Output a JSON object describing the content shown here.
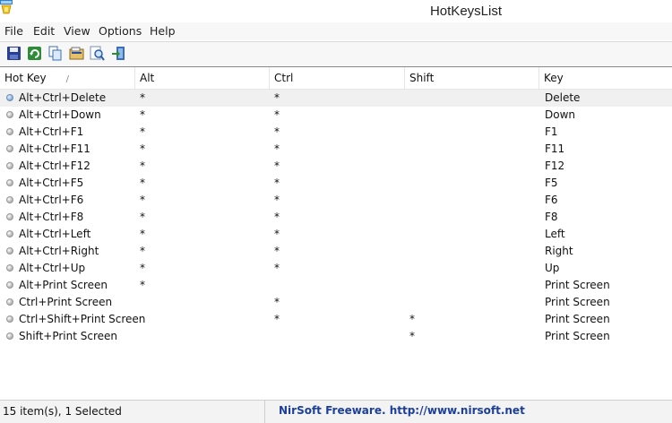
{
  "window": {
    "title": "HotKeysList"
  },
  "menu": [
    "File",
    "Edit",
    "View",
    "Options",
    "Help"
  ],
  "toolbar": [
    {
      "name": "save-icon"
    },
    {
      "name": "refresh-icon"
    },
    {
      "name": "copy-icon"
    },
    {
      "name": "properties-icon"
    },
    {
      "name": "find-icon"
    },
    {
      "name": "exit-icon"
    }
  ],
  "columns": [
    "Hot Key",
    "Alt",
    "Ctrl",
    "Shift",
    "Key"
  ],
  "sort_indicator": "/",
  "rows": [
    {
      "hotkey": "Alt+Ctrl+Delete",
      "alt": "*",
      "ctrl": "*",
      "shift": "",
      "key": "Delete",
      "selected": true
    },
    {
      "hotkey": "Alt+Ctrl+Down",
      "alt": "*",
      "ctrl": "*",
      "shift": "",
      "key": "Down"
    },
    {
      "hotkey": "Alt+Ctrl+F1",
      "alt": "*",
      "ctrl": "*",
      "shift": "",
      "key": "F1"
    },
    {
      "hotkey": "Alt+Ctrl+F11",
      "alt": "*",
      "ctrl": "*",
      "shift": "",
      "key": "F11"
    },
    {
      "hotkey": "Alt+Ctrl+F12",
      "alt": "*",
      "ctrl": "*",
      "shift": "",
      "key": "F12"
    },
    {
      "hotkey": "Alt+Ctrl+F5",
      "alt": "*",
      "ctrl": "*",
      "shift": "",
      "key": "F5"
    },
    {
      "hotkey": "Alt+Ctrl+F6",
      "alt": "*",
      "ctrl": "*",
      "shift": "",
      "key": "F6"
    },
    {
      "hotkey": "Alt+Ctrl+F8",
      "alt": "*",
      "ctrl": "*",
      "shift": "",
      "key": "F8"
    },
    {
      "hotkey": "Alt+Ctrl+Left",
      "alt": "*",
      "ctrl": "*",
      "shift": "",
      "key": "Left"
    },
    {
      "hotkey": "Alt+Ctrl+Right",
      "alt": "*",
      "ctrl": "*",
      "shift": "",
      "key": "Right"
    },
    {
      "hotkey": "Alt+Ctrl+Up",
      "alt": "*",
      "ctrl": "*",
      "shift": "",
      "key": "Up"
    },
    {
      "hotkey": "Alt+Print Screen",
      "alt": "*",
      "ctrl": "",
      "shift": "",
      "key": "Print Screen"
    },
    {
      "hotkey": "Ctrl+Print Screen",
      "alt": "",
      "ctrl": "*",
      "shift": "",
      "key": "Print Screen"
    },
    {
      "hotkey": "Ctrl+Shift+Print Screen",
      "alt": "",
      "ctrl": "*",
      "shift": "*",
      "key": "Print Screen"
    },
    {
      "hotkey": "Shift+Print Screen",
      "alt": "",
      "ctrl": "",
      "shift": "*",
      "key": "Print Screen"
    }
  ],
  "status": {
    "count": "15 item(s), 1 Selected",
    "credit": "NirSoft Freeware.  http://www.nirsoft.net"
  }
}
